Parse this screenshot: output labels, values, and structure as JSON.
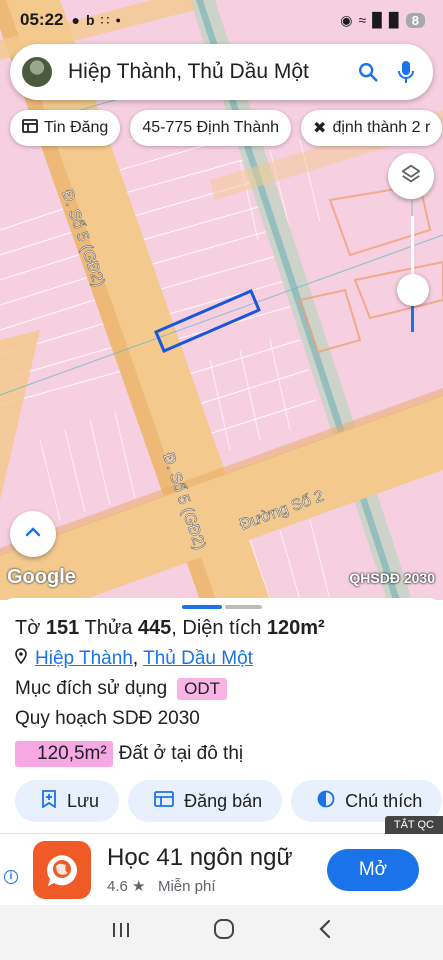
{
  "status": {
    "time": "05:22",
    "battery": "8",
    "left_icons": [
      "flame-icon",
      "b-icon",
      "dots-app-icon",
      "dot-icon"
    ],
    "right_icons": [
      "location-icon",
      "wifi-icon",
      "signal-icon",
      "signal2-icon"
    ]
  },
  "search": {
    "text": "Hiệp Thành, Thủ Dầu Một"
  },
  "chips": [
    {
      "icon": "listing-icon",
      "label": "Tin Đăng"
    },
    {
      "icon": "",
      "label": "45-775 Định Thành"
    },
    {
      "icon": "tools-icon",
      "label": "định thành 2 r"
    }
  ],
  "map": {
    "road1": "Đ. Số 5 (GĐ2)",
    "road2": "Đ. Số 5 (GĐ2)",
    "road3": "Đường Số 2",
    "google": "Google",
    "overlay": "QHSDĐ 2030",
    "zoom_level": 0.45,
    "colors": {
      "residential": "#f6cfe0",
      "road": "#f3c98e",
      "parcel_border": "#f0b48c",
      "highlight": "#1a56db"
    }
  },
  "sheet": {
    "to_label": "Tờ",
    "to_value": "151",
    "thua_label": "Thửa",
    "thua_value": "445",
    "dt_label": ", Diện tích",
    "dt_value": "120m²",
    "ward": "Hiệp Thành",
    "sep": ",",
    "city": "Thủ Dầu Một",
    "purpose_label": "Mục đích sử dụng",
    "purpose_value": "ODT",
    "plan_label": "Quy hoạch SDĐ 2030",
    "area_value": "120,5m²",
    "area_desc": "Đất ở tại đô thị",
    "actions": [
      {
        "icon": "bookmark-plus-icon",
        "label": "Lưu"
      },
      {
        "icon": "post-icon",
        "label": "Đăng bán"
      },
      {
        "icon": "legend-icon",
        "label": "Chú thích"
      }
    ]
  },
  "ad": {
    "close_label": "TẮT QC",
    "app_name": "Học 41 ngôn ngữ",
    "rating": "4.6 ★",
    "price": "Miễn phí",
    "open_label": "Mở"
  },
  "nav": [
    "recent-apps-icon",
    "home-icon",
    "back-icon"
  ]
}
